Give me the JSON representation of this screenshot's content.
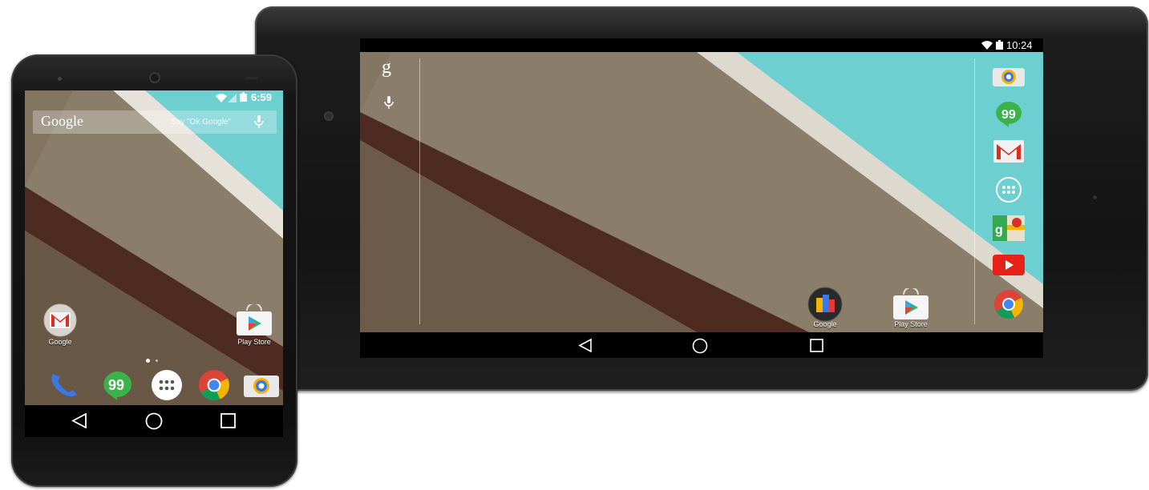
{
  "tablet": {
    "status_time": "10:24",
    "google_g": "g",
    "desktop_apps": [
      {
        "label": "Google",
        "icon": "google-folder-icon"
      },
      {
        "label": "Play Store",
        "icon": "play-store-icon"
      }
    ],
    "dock_icons": [
      "camera-icon",
      "hangouts-icon",
      "gmail-icon",
      "app-drawer-icon",
      "maps-icon",
      "youtube-icon",
      "chrome-icon"
    ]
  },
  "phone": {
    "status_time": "6:59",
    "search": {
      "logo": "Google",
      "hint": "Say \"Ok Google\""
    },
    "home_apps": [
      {
        "label": "Google",
        "icon": "gmail-folder-icon"
      },
      {
        "label": "Play Store",
        "icon": "play-store-icon"
      }
    ],
    "dock_icons": [
      "phone-icon",
      "hangouts-icon",
      "app-drawer-icon",
      "chrome-icon",
      "camera-icon"
    ]
  },
  "colors": {
    "teal": "#6ecfd1",
    "taupe": "#8a7e6a",
    "maroon": "#4c2a20",
    "cream": "#e9e6df"
  }
}
